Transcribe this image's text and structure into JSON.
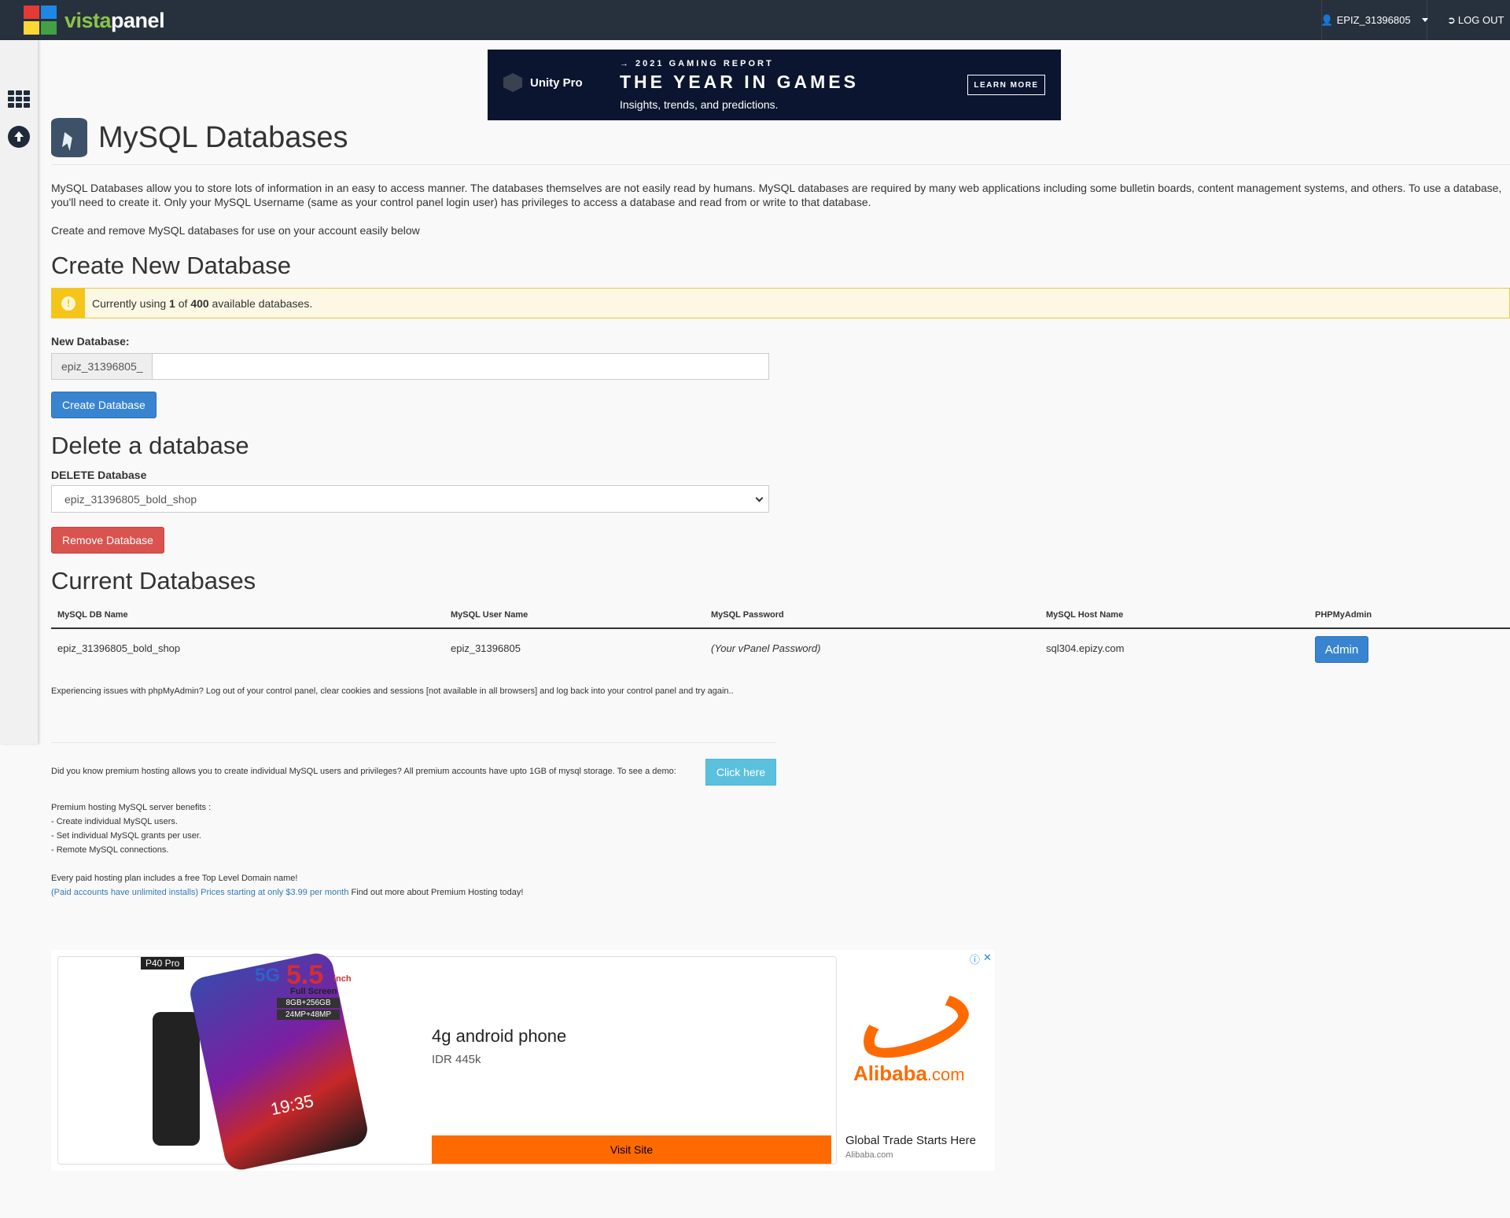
{
  "topbar": {
    "logo_vista": "vista",
    "logo_panel": "panel",
    "username": "EPIZ_31396805",
    "logout": "LOG OUT"
  },
  "top_ad": {
    "brand": "Unity Pro",
    "kicker": "→ 2021 GAMING REPORT",
    "headline": "THE YEAR IN GAMES",
    "tagline": "Insights, trends, and predictions.",
    "cta": "LEARN MORE"
  },
  "page": {
    "title": "MySQL Databases",
    "intro": "MySQL Databases allow you to store lots of information in an easy to access manner. The databases themselves are not easily read by humans. MySQL databases are required by many web applications including some bulletin boards, content management systems, and others. To use a database, you'll need to create it. Only your MySQL Username (same as your control panel login user) has privileges to access a database and read from or write to that database.",
    "intro2": "Create and remove MySQL databases for use on your account easily below"
  },
  "create": {
    "heading": "Create New Database",
    "alert_prefix": "Currently using ",
    "alert_used": "1",
    "alert_of": " of ",
    "alert_total": "400",
    "alert_suffix": " available databases.",
    "field_label": "New Database:",
    "prefix": "epiz_31396805_",
    "input_value": "",
    "button": "Create Database"
  },
  "delete": {
    "heading": "Delete a database",
    "field_label": "DELETE Database",
    "selected": "epiz_31396805_bold_shop",
    "button": "Remove Database"
  },
  "current": {
    "heading": "Current Databases",
    "columns": [
      "MySQL DB Name",
      "MySQL User Name",
      "MySQL Password",
      "MySQL Host Name",
      "PHPMyAdmin"
    ],
    "rows": [
      {
        "db_name": "epiz_31396805_bold_shop",
        "user": "epiz_31396805",
        "password": "(Your vPanel Password)",
        "host": "sql304.epizy.com",
        "action": "Admin"
      }
    ],
    "issues": "Experiencing issues with phpMyAdmin? Log out of your control panel, clear cookies and sessions [not available in all browsers] and log back into your control panel and try again.."
  },
  "premium": {
    "question": "Did you know premium hosting allows you to create individual MySQL users and privileges? All premium accounts have upto 1GB of mysql storage. To see a demo:",
    "button": "Click here",
    "benefits_title": "Premium hosting MySQL server benefits :",
    "benefits": [
      "- Create individual MySQL users.",
      "- Set individual MySQL grants per user.",
      "- Remote MySQL connections."
    ],
    "tld": "Every paid hosting plan includes a free Top Level Domain name!",
    "link_text": "(Paid accounts have unlimited installs) Prices starting at only $3.99 per month",
    "after_link": " Find out more about Premium Hosting today!"
  },
  "bottom_ad": {
    "badge": "P40 Pro",
    "spec_5g": "5G",
    "spec_size": "5.5",
    "spec_unit": "inch",
    "spec_screen": "Full Screen",
    "spec_memory": "8GB+256GB",
    "spec_camera": "24MP+48MP",
    "phone_time": "19:35",
    "title": "4g android phone",
    "price": "IDR 445k",
    "cta": "Visit Site",
    "advertiser_logo": "Alibaba",
    "advertiser_logo_suffix": ".com",
    "slogan": "Global Trade Starts Here",
    "domain": "Alibaba.com",
    "info_icon": "ⓘ",
    "close_icon": "✕"
  }
}
